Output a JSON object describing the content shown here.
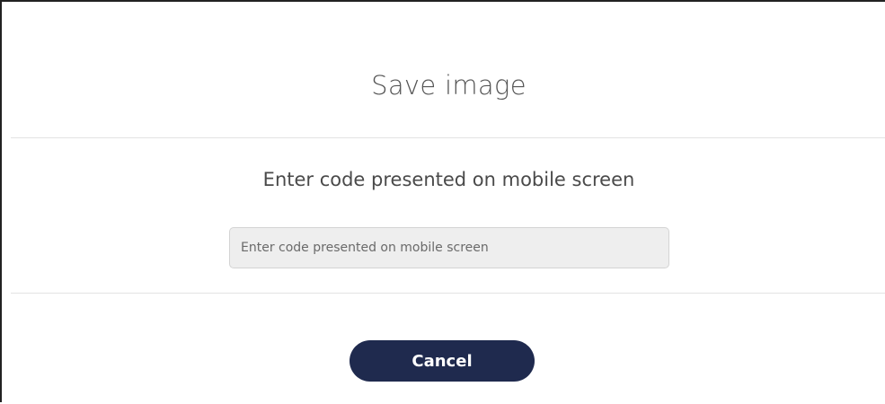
{
  "dialog": {
    "title": "Save image",
    "prompt": "Enter code presented on mobile screen",
    "code_input": {
      "value": "",
      "placeholder": "Enter code presented on mobile screen"
    },
    "cancel_label": "Cancel"
  },
  "colors": {
    "button_background": "#1f2a4e",
    "input_background": "#eeeeee",
    "divider": "#e3e3e3"
  }
}
